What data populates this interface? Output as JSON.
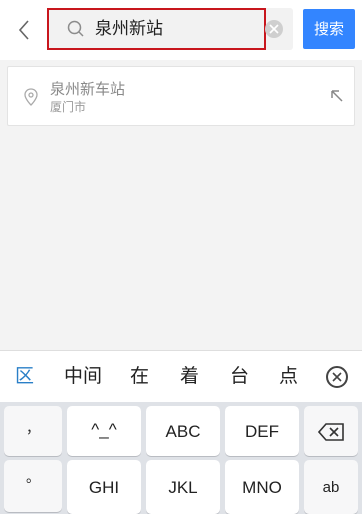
{
  "search": {
    "value": "泉州新站",
    "button_label": "搜索"
  },
  "suggestion": {
    "name": "泉州新车站",
    "city": "厦门市"
  },
  "candidates": [
    "中间",
    "在",
    "着",
    "台",
    "点"
  ],
  "ime": {
    "region_label": "区"
  },
  "keyboard": {
    "punct_comma": "，",
    "punct_period": "。",
    "key_1": "^_^",
    "key_2": "ABC",
    "key_3": "DEF",
    "key_4": "GHI",
    "key_5": "JKL",
    "key_6": "MNO",
    "key_side": "ab"
  },
  "colors": {
    "accent": "#3385ff",
    "highlight": "#c8161d",
    "region_icon": "#2a7fc7"
  },
  "icons": [
    "back-arrow-icon",
    "search-icon",
    "clear-icon",
    "location-pin-icon",
    "fill-arrow-icon",
    "close-circle-icon",
    "backspace-icon"
  ]
}
